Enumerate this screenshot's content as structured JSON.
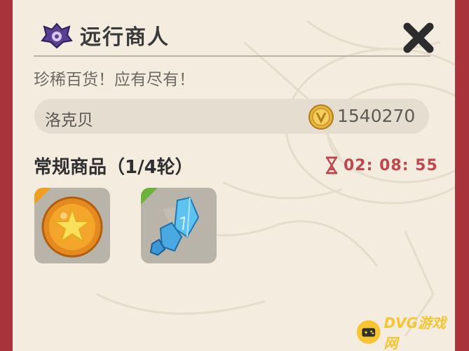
{
  "header": {
    "title": "远行商人",
    "logo_icon": "purple-emblem-icon",
    "close_icon": "close-x-icon"
  },
  "subtitle": "珍稀百货！应有尽有！",
  "merchant": {
    "name": "洛克贝",
    "currency_icon": "gold-coin-icon",
    "currency_amount": "1540270"
  },
  "section": {
    "title": "常规商品（1/4轮）",
    "timer_icon": "hourglass-icon",
    "timer": "02: 08: 55"
  },
  "items": [
    {
      "icon": "orange-star-orb-icon",
      "corner_color": "#f0a020"
    },
    {
      "icon": "blue-crystal-icon",
      "corner_color": "#6bb33b"
    }
  ],
  "watermark": {
    "icon": "gamepad-icon",
    "text": "DVG游戏网"
  },
  "colors": {
    "frame": "#a8333a",
    "panel": "#f4ecdf",
    "timer": "#c0474c",
    "title": "#3a3a3c"
  }
}
